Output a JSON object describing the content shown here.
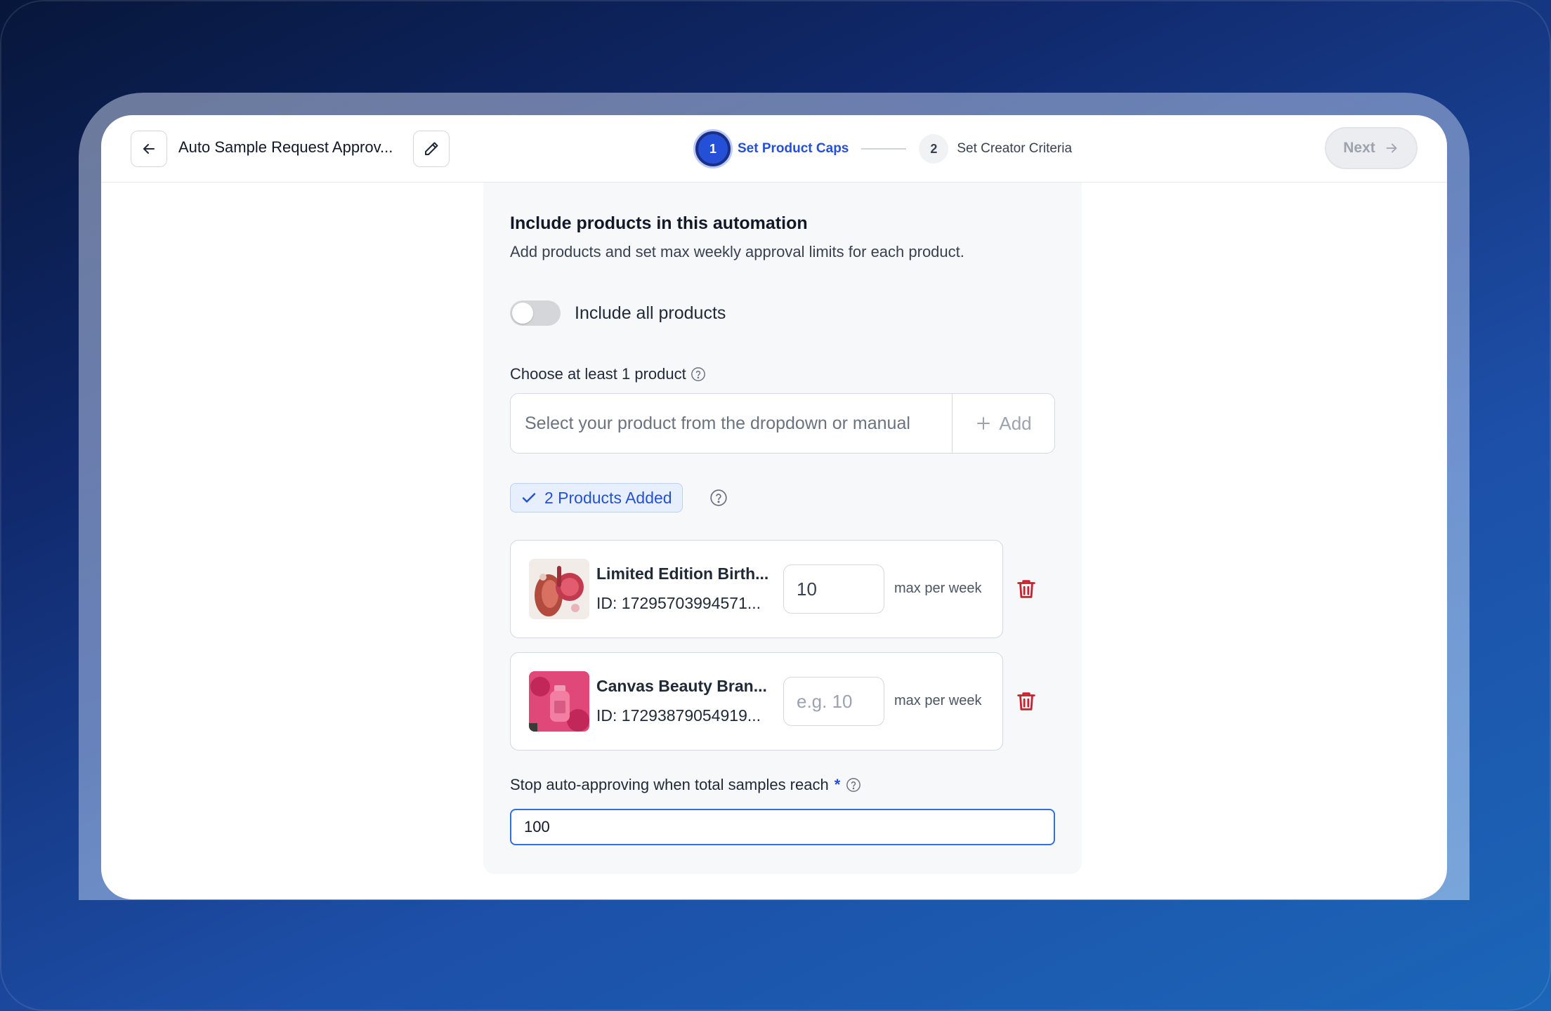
{
  "header": {
    "title": "Auto Sample Request Approv...",
    "back_icon": "arrow-left-icon",
    "edit_icon": "pencil-icon",
    "steps": [
      {
        "number": "1",
        "label": "Set Product Caps",
        "state": "active"
      },
      {
        "number": "2",
        "label": "Set Creator Criteria",
        "state": "inactive"
      }
    ],
    "next_label": "Next",
    "next_icon": "arrow-right-icon"
  },
  "section": {
    "title": "Include products in this automation",
    "description": "Add products and set max weekly approval limits for each product.",
    "toggle_label": "Include all products",
    "toggle_on": false,
    "choose_label": "Choose at least 1 product",
    "product_input_placeholder": "Select your product from the dropdown or manual",
    "add_label": "Add",
    "badge_label": "2 Products Added"
  },
  "products": [
    {
      "name": "Limited Edition Birth...",
      "id": "ID: 17295703994571...",
      "cap_value": "10",
      "cap_placeholder": "",
      "max_label": "max per week"
    },
    {
      "name": "Canvas Beauty Bran...",
      "id": "ID: 17293879054919...",
      "cap_value": "",
      "cap_placeholder": "e.g. 10",
      "max_label": "max per week"
    }
  ],
  "stop": {
    "label": "Stop auto-approving when total samples reach",
    "required_marker": "*",
    "value": "100"
  },
  "colors": {
    "accent": "#2450d8",
    "danger": "#c8242f"
  }
}
